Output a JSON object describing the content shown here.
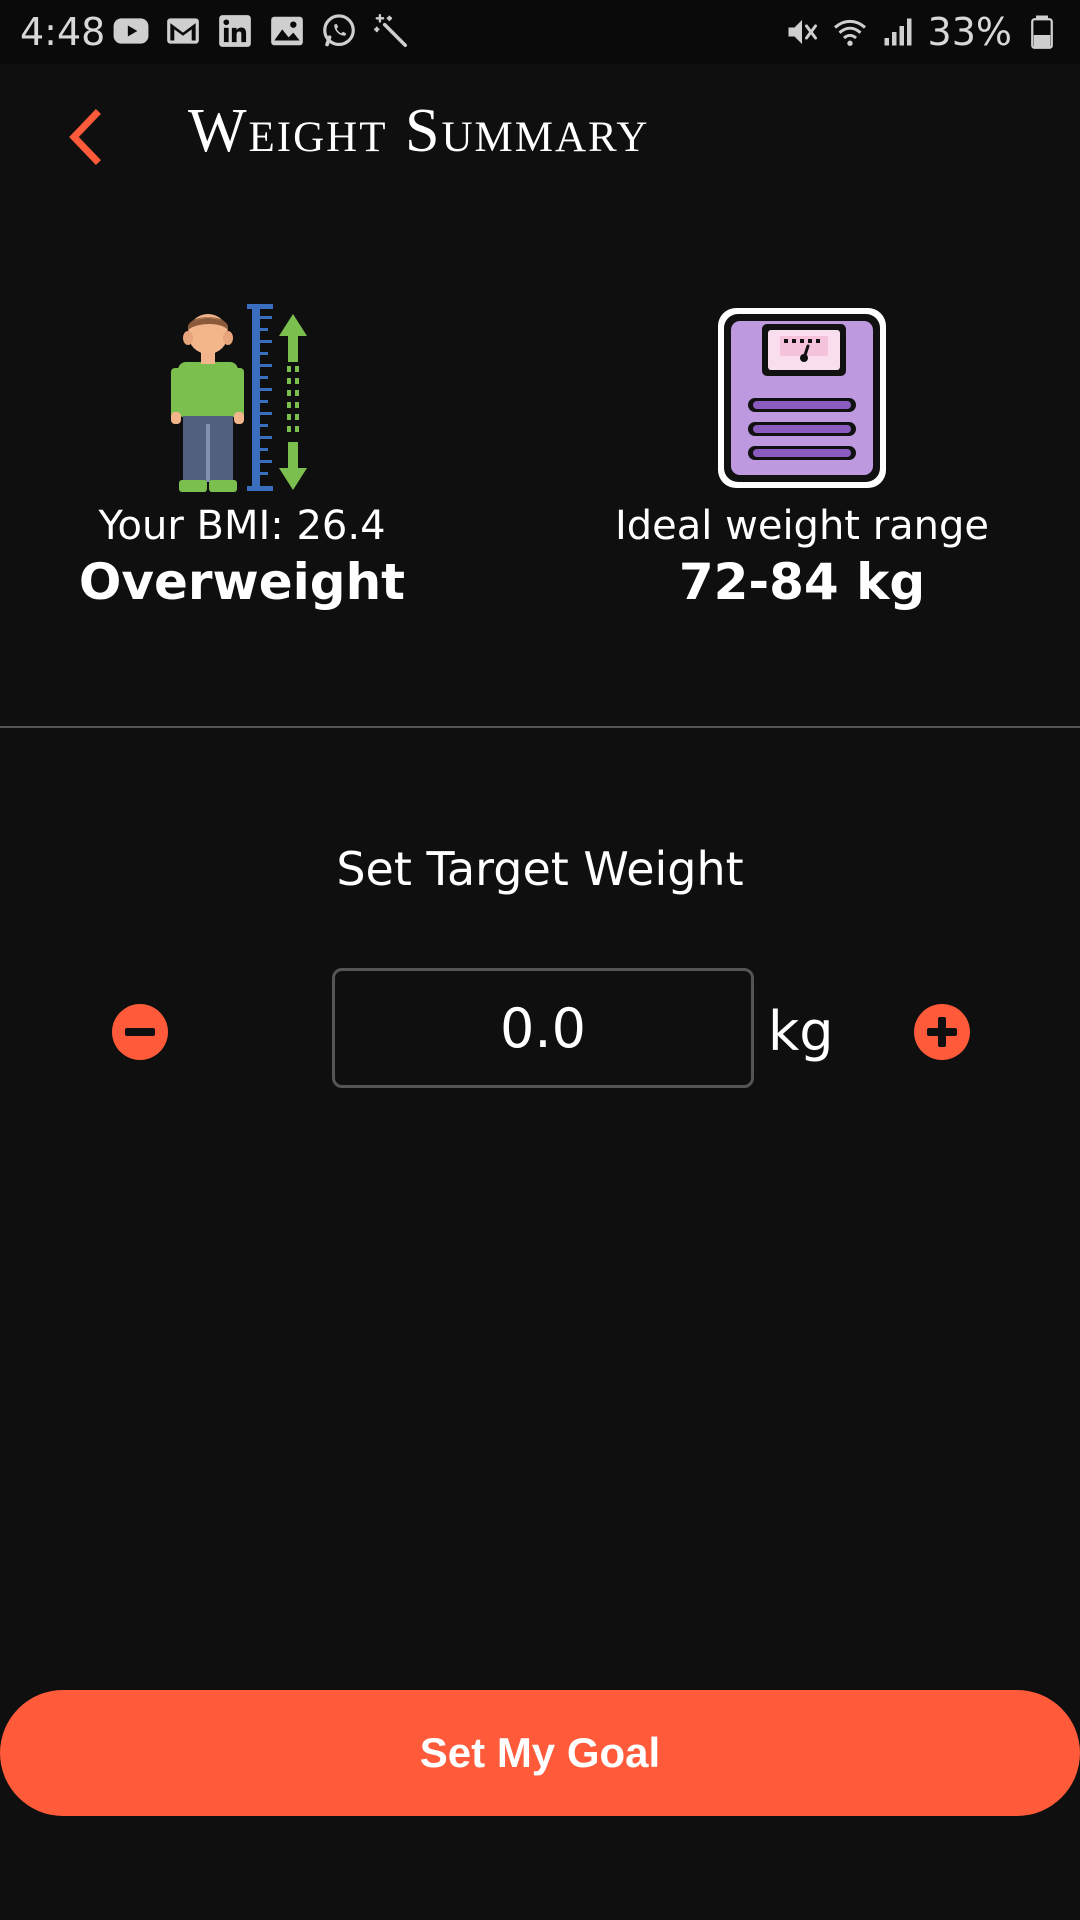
{
  "status_bar": {
    "time": "4:48",
    "battery": "33%",
    "left_icons": [
      "youtube-icon",
      "gmail-icon",
      "linkedin-icon",
      "gallery-icon",
      "whatsapp-icon",
      "magic-wand-icon"
    ],
    "right_icons": [
      "mute-icon",
      "wifi-icon",
      "signal-icon",
      "battery-icon"
    ]
  },
  "header": {
    "title": "Weight Summary",
    "back_icon": "chevron-left-icon"
  },
  "summary": {
    "bmi_label": "Your BMI: 26.4",
    "bmi_category": "Overweight",
    "range_label": "Ideal weight range",
    "range_value": "72-84 kg"
  },
  "target": {
    "heading": "Set Target Weight",
    "value": "0.0",
    "unit": "kg"
  },
  "goal_button": "Set My Goal",
  "colors": {
    "accent": "#ff5a3a",
    "background": "#0f0f0f",
    "divider": "#555555"
  }
}
